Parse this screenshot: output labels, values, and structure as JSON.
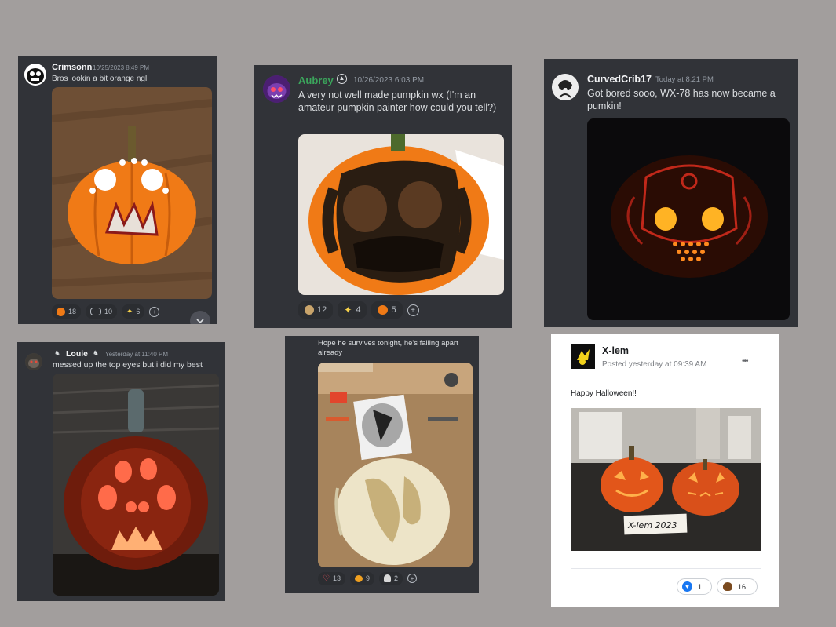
{
  "posts": [
    {
      "user": "Crimsonn",
      "time": "10/25/2023 8:49 PM",
      "text": "Bros lookin a bit orange ngl",
      "name_color": "#f2f3f5",
      "reactions": [
        {
          "emoji": "orange-circle-icon",
          "count": "18"
        },
        {
          "emoji": "goggles-icon",
          "count": "10"
        },
        {
          "emoji": "sparkles-icon",
          "count": "6"
        }
      ]
    },
    {
      "user": "Aubrey",
      "time": "10/26/2023 6:03 PM",
      "text": "A very not well made pumpkin wx (I'm an amateur pumpkin painter how could you tell?)",
      "name_color": "#3ba55c",
      "reactions": [
        {
          "emoji": "skull-face-icon",
          "count": "12"
        },
        {
          "emoji": "sparkles-icon",
          "count": "4"
        },
        {
          "emoji": "jack-o-lantern-icon",
          "count": "5"
        }
      ]
    },
    {
      "user": "CurvedCrib17",
      "time": "Today at 8:21 PM",
      "text": "Got bored sooo, WX-78 has now became a pumkin!",
      "name_color": "#f2f3f5",
      "reactions": []
    },
    {
      "user": "Louie",
      "time": "Yesterday at 11:40 PM",
      "text": "messed up the top eyes but i did my best",
      "name_color": "#f2f3f5",
      "reactions": []
    },
    {
      "user": "",
      "time": "",
      "text": "Hope he survives tonight, he's falling apart already",
      "name_color": "#f2f3f5",
      "reactions": [
        {
          "emoji": "heart-outline-icon",
          "count": "13"
        },
        {
          "emoji": "pumpkin-icon",
          "count": "9"
        },
        {
          "emoji": "ghost-icon",
          "count": "2"
        }
      ]
    }
  ],
  "fb_post": {
    "user": "X-lem",
    "time": "Posted yesterday at 09:39 AM",
    "text": "Happy Halloween!!",
    "sign_text": "X-lem 2023",
    "more_label": "•••",
    "reactions": [
      {
        "emoji": "like-heart-icon",
        "count": "1"
      },
      {
        "emoji": "poop-icon",
        "count": "16"
      }
    ]
  },
  "colors": {
    "background": "#a29e9d",
    "discord_card": "#313338",
    "pumpkin_orange": "#f07a16"
  }
}
